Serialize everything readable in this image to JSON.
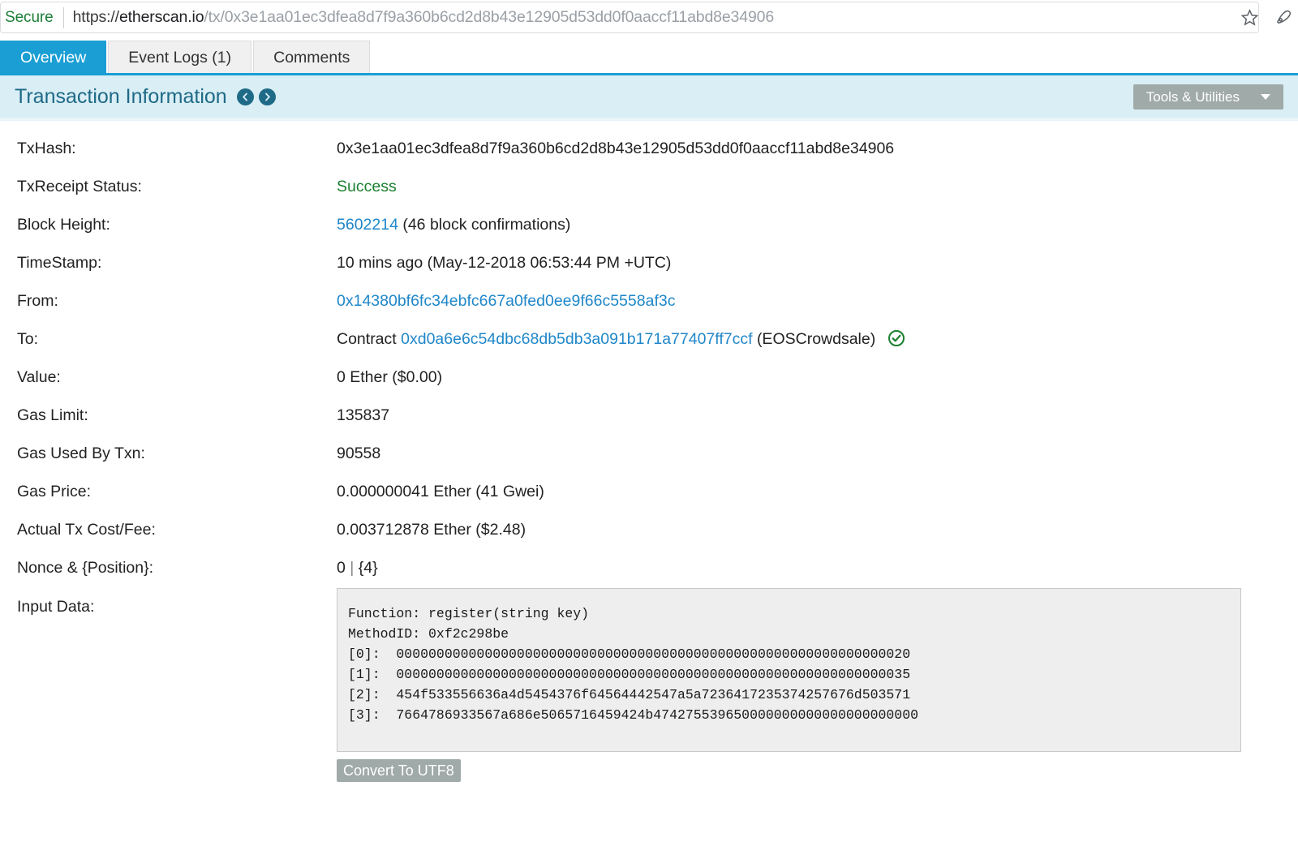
{
  "browser": {
    "security_label": "Secure",
    "url_scheme": "https://",
    "url_host": "etherscan.io",
    "url_path": "/tx/0x3e1aa01ec3dfea8d7f9a360b6cd2d8b43e12905d53dd0f0aaccf11abd8e34906",
    "bookmark_icon": "star-icon",
    "extension_icon": "extension-icon"
  },
  "tabs": [
    {
      "label": "Overview",
      "active": true
    },
    {
      "label": "Event Logs (1)",
      "active": false
    },
    {
      "label": "Comments",
      "active": false
    }
  ],
  "panel": {
    "title": "Transaction Information",
    "prev_icon": "chevron-left-icon",
    "next_icon": "chevron-right-icon",
    "tools_label": "Tools & Utilities",
    "tools_caret": "chevron-down-icon"
  },
  "fields": {
    "txhash_label": "TxHash:",
    "txhash_value": "0x3e1aa01ec3dfea8d7f9a360b6cd2d8b43e12905d53dd0f0aaccf11abd8e34906",
    "status_label": "TxReceipt Status:",
    "status_value": "Success",
    "block_label": "Block Height:",
    "block_value": "5602214",
    "block_confirmations": "(46 block confirmations)",
    "timestamp_label": "TimeStamp:",
    "timestamp_value": "10 mins ago (May-12-2018 06:53:44 PM +UTC)",
    "from_label": "From:",
    "from_value": "0x14380bf6fc34ebfc667a0fed0ee9f66c5558af3c",
    "to_label": "To:",
    "to_prefix": "Contract",
    "to_value": "0xd0a6e6c54dbc68db5db3a091b171a77407ff7ccf",
    "to_suffix": "(EOSCrowdsale)",
    "to_verified_icon": "verified-check-icon",
    "value_label": "Value:",
    "value_value": "0 Ether ($0.00)",
    "gaslimit_label": "Gas Limit:",
    "gaslimit_value": "135837",
    "gasused_label": "Gas Used By Txn:",
    "gasused_value": "90558",
    "gasprice_label": "Gas Price:",
    "gasprice_value": "0.000000041 Ether (41 Gwei)",
    "txcost_label": "Actual Tx Cost/Fee:",
    "txcost_value": "0.003712878 Ether ($2.48)",
    "nonce_label": "Nonce & {Position}:",
    "nonce_value": "0",
    "nonce_separator": "|",
    "nonce_position": "{4}",
    "inputdata_label": "Input Data:"
  },
  "input_data": {
    "function_line": "Function: register(string key)",
    "blank_line": "",
    "methodid_line": "MethodID: 0xf2c298be",
    "rows": [
      "[0]:  0000000000000000000000000000000000000000000000000000000000000020",
      "[1]:  0000000000000000000000000000000000000000000000000000000000000035",
      "[2]:  454f533556636a4d5454376f64564442547a5a7236417235374257676d503571",
      "[3]:  7664786933567a686e5065716459424b474275539650000000000000000000000"
    ],
    "convert_button": "Convert To UTF8",
    "resize_icon": "resize-grip-icon"
  },
  "colors": {
    "accent_blue": "#1a9ed4",
    "panel_bg": "#d9eef5",
    "link": "#1f87c9",
    "success": "#1a7f2e",
    "button_gray": "#a0aaa8"
  }
}
